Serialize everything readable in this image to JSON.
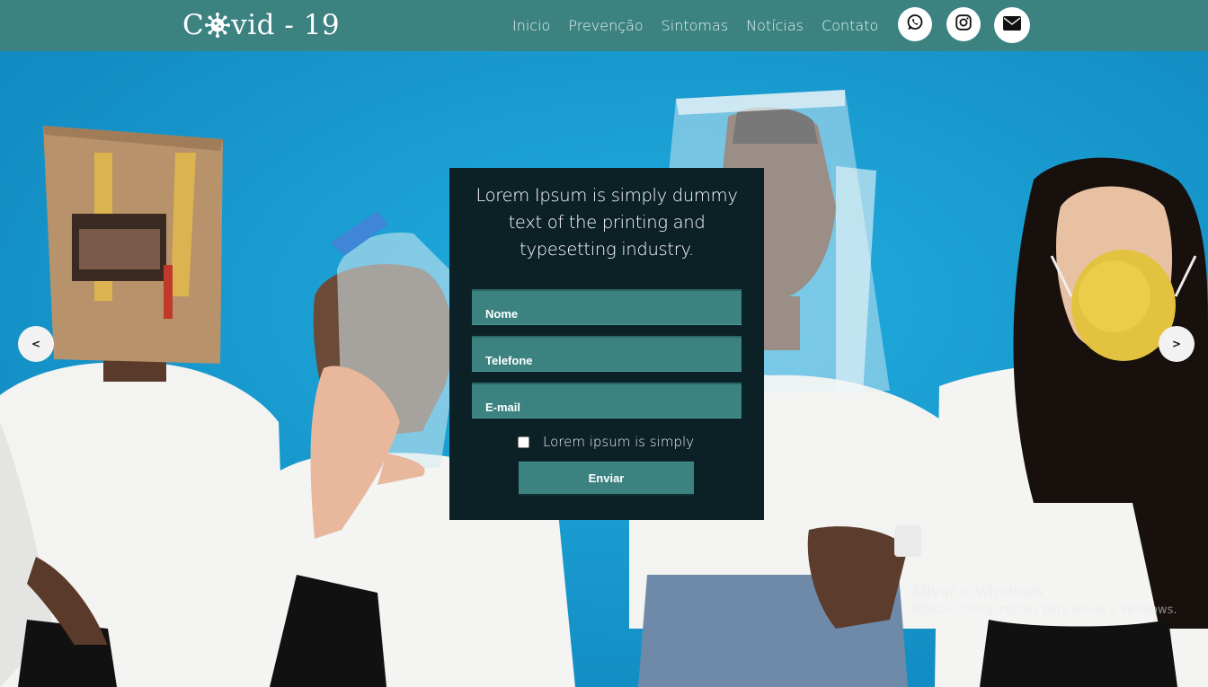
{
  "header": {
    "logo_prefix": "C",
    "logo_suffix": "vid - 19",
    "nav": [
      "Inicio",
      "Prevenção",
      "Sintomas",
      "Notícias",
      "Contato"
    ],
    "social_icons": [
      "whatsapp-icon",
      "instagram-icon",
      "envelope-icon"
    ]
  },
  "carousel": {
    "prev_label": "<",
    "next_label": ">"
  },
  "form": {
    "heading": "Lorem Ipsum is simply dummy text of the printing and typesetting industry.",
    "name_placeholder": "Nome",
    "phone_placeholder": "Telefone",
    "email_placeholder": "E-mail",
    "checkbox_label": "Lorem ipsum is simply",
    "checkbox_checked": false,
    "submit_label": "Enviar"
  },
  "watermark": {
    "title": "Ativar o Windows",
    "subtitle": "Acesse Configurações para ativar o Windows."
  },
  "colors": {
    "header_bg": "#3b8281",
    "panel_bg": "#0b2126",
    "field_bg": "#3b8281",
    "hero_bg": "#1a9fd4"
  }
}
